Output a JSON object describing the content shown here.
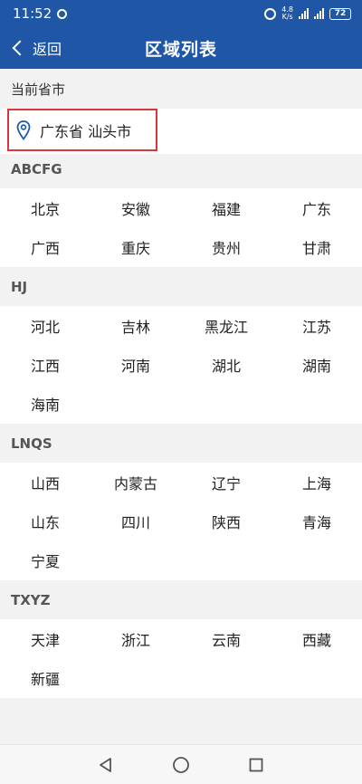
{
  "status": {
    "time": "11:52",
    "net_speed_value": "4.8",
    "net_speed_unit": "K/s",
    "battery": "72"
  },
  "nav": {
    "back_label": "返回",
    "title": "区域列表"
  },
  "current": {
    "label": "当前省市",
    "value": "广东省 汕头市"
  },
  "sections": [
    {
      "title": "ABCFG",
      "items": [
        "北京",
        "安徽",
        "福建",
        "广东",
        "广西",
        "重庆",
        "贵州",
        "甘肃"
      ]
    },
    {
      "title": "HJ",
      "items": [
        "河北",
        "吉林",
        "黑龙江",
        "江苏",
        "江西",
        "河南",
        "湖北",
        "湖南",
        "海南"
      ]
    },
    {
      "title": "LNQS",
      "items": [
        "山西",
        "内蒙古",
        "辽宁",
        "上海",
        "山东",
        "四川",
        "陕西",
        "青海",
        "宁夏"
      ]
    },
    {
      "title": "TXYZ",
      "items": [
        "天津",
        "浙江",
        "云南",
        "西藏",
        "新疆"
      ]
    }
  ],
  "colors": {
    "primary": "#1f56a6",
    "highlight_border": "#d9363e"
  }
}
